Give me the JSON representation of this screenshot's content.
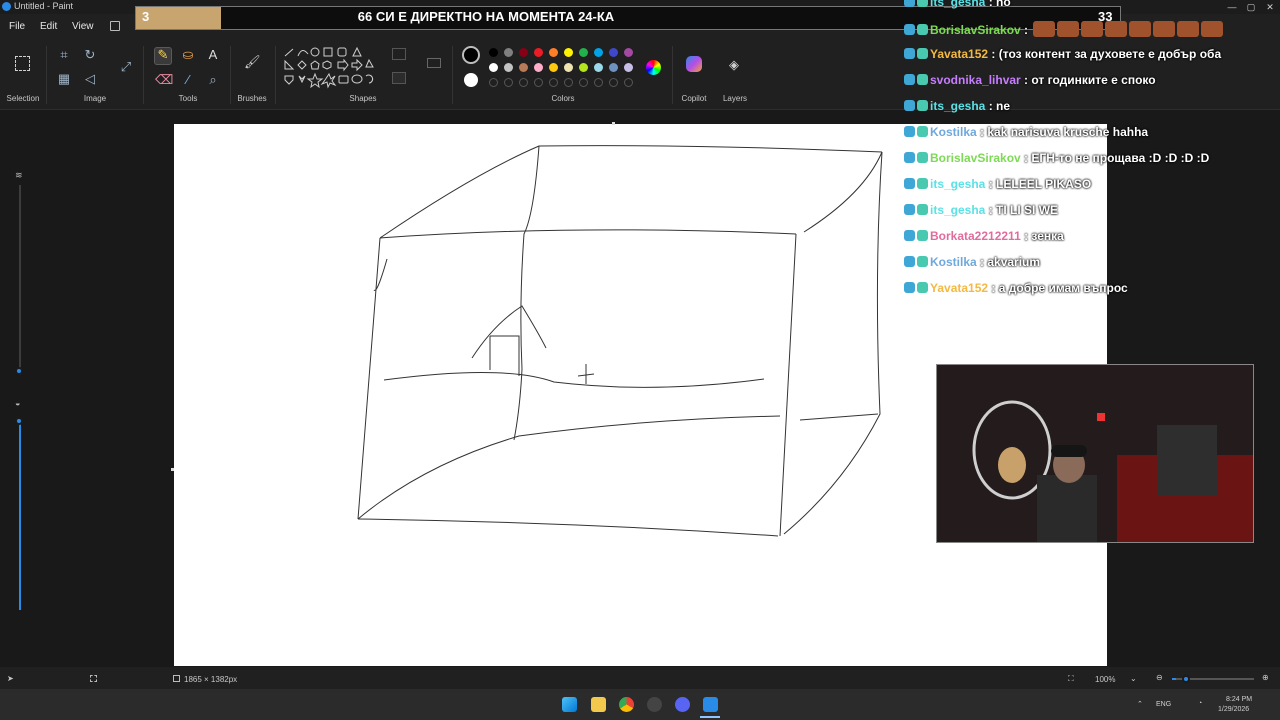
{
  "window": {
    "title": "Untitled - Paint",
    "controls": [
      "—",
      "▢",
      "✕"
    ]
  },
  "menu": {
    "file": "File",
    "edit": "Edit",
    "view": "View"
  },
  "ribbon": {
    "groups": {
      "selection": "Selection",
      "image": "Image",
      "tools": "Tools",
      "brushes": "Brushes",
      "shapes": "Shapes",
      "colors": "Colors",
      "copilot": "Copilot",
      "layers": "Layers"
    },
    "palette_row1": [
      "#000000",
      "#7f7f7f",
      "#880015",
      "#ed1c24",
      "#ff7f27",
      "#fff200",
      "#22b14c",
      "#00a2e8",
      "#3f48cc",
      "#a349a4"
    ],
    "palette_row2": [
      "#ffffff",
      "#c3c3c3",
      "#b97a57",
      "#ffaec9",
      "#ffc90e",
      "#efe4b0",
      "#b5e61d",
      "#99d9ea",
      "#7092be",
      "#c8bfe7"
    ],
    "primary_color": "#000000",
    "secondary_color": "#ffffff"
  },
  "status": {
    "canvas_size": "1865 × 1382px",
    "zoom": "100%",
    "zoom_slider_level": 0.05
  },
  "tray": {
    "language": "ENG",
    "time": "8:24 PM",
    "date": "1/29/2026"
  },
  "stream": {
    "banner_left": "3",
    "banner_title": "66 СИ Е ДИРЕКТНО НА МОМЕНТА 24-КА",
    "banner_right": "33",
    "chat": [
      {
        "user": "its_gesha",
        "sep": " : ",
        "msg": "no",
        "color": "#5ce1e6"
      },
      {
        "user": "BorislavSirakov",
        "sep": " : ",
        "msg": "",
        "color": "#7ed957"
      },
      {
        "user": "Yavata152",
        "sep": " : ",
        "msg": "(тоз контент за духовете е добър оба",
        "color": "#f4b942"
      },
      {
        "user": "svodnika_lihvar",
        "sep": " : ",
        "msg": "от годинките е споко",
        "color": "#c77dff"
      },
      {
        "user": "its_gesha",
        "sep": " : ",
        "msg": "ne",
        "color": "#5ce1e6"
      },
      {
        "user": "Kostilka",
        "sep": " : ",
        "msg": "kak narisuva krusche hahha",
        "color": "#6fa8dc"
      },
      {
        "user": "BorislavSirakov",
        "sep": " : ",
        "msg": "ЕГН-то не прощава :D :D :D :D",
        "color": "#7ed957"
      },
      {
        "user": "its_gesha",
        "sep": " : ",
        "msg": "LELEEL PIKASO",
        "color": "#5ce1e6"
      },
      {
        "user": "its_gesha",
        "sep": " : ",
        "msg": "TI LI SI WE",
        "color": "#5ce1e6"
      },
      {
        "user": "Borkata2212211",
        "sep": " : ",
        "msg": "зенка",
        "color": "#e06c9f"
      },
      {
        "user": "Kostilka",
        "sep": " : ",
        "msg": "akvarium",
        "color": "#6fa8dc"
      },
      {
        "user": "Yavata152",
        "sep": " : ",
        "msg": "а добре имам въпрос",
        "color": "#f4b942"
      }
    ]
  }
}
